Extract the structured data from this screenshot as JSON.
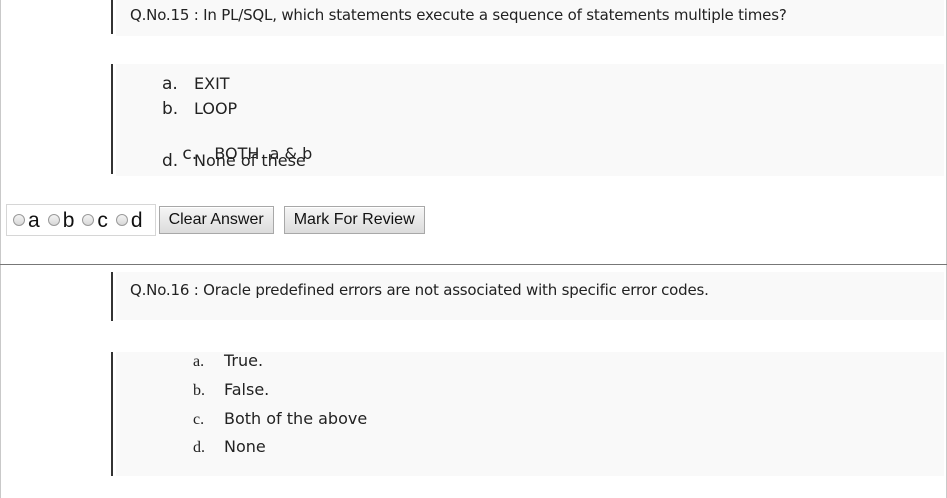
{
  "q15": {
    "question": "Q.No.15 : In PL/SQL, which statements execute a sequence of statements multiple times?",
    "options": [
      {
        "letter": "a.",
        "text": "EXIT"
      },
      {
        "letter": "b.",
        "text": "LOOP"
      },
      {
        "letter": "c.",
        "text": "BOTH  a & b"
      },
      {
        "letter": "d.",
        "text": "None of these"
      }
    ]
  },
  "answer_bar": {
    "radios": [
      {
        "label": "a"
      },
      {
        "label": "b"
      },
      {
        "label": "c"
      },
      {
        "label": "d"
      }
    ],
    "clear_label": "Clear Answer",
    "review_label": "Mark For Review"
  },
  "q16": {
    "question": "Q.No.16  : Oracle predefined errors are not associated with specific error codes.",
    "options": [
      {
        "letter": "a.",
        "text": "True."
      },
      {
        "letter": "b.",
        "text": "False."
      },
      {
        "letter": "c.",
        "text": "Both of the above"
      },
      {
        "letter": "d.",
        "text": "None"
      }
    ]
  }
}
